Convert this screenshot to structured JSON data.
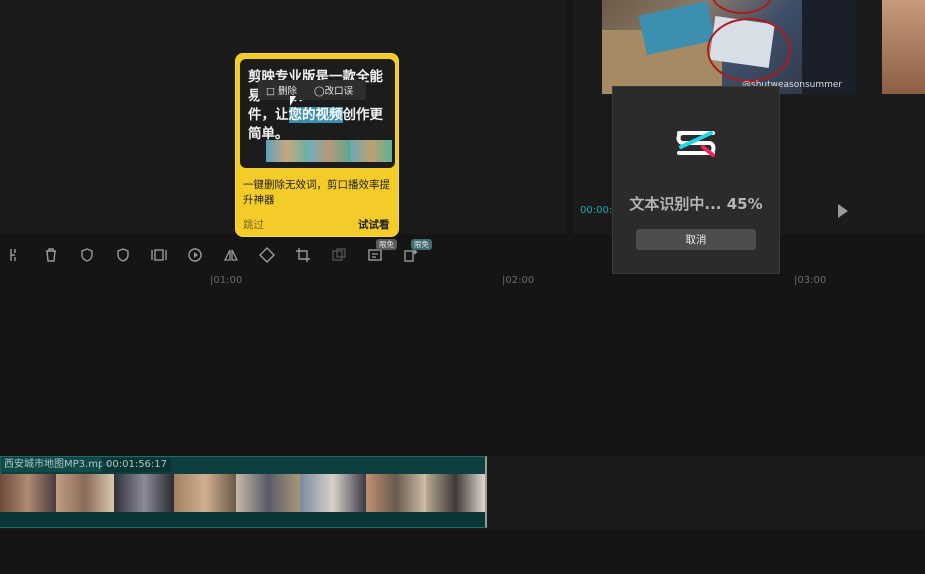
{
  "player": {
    "watermark": "@shutweasonsummer",
    "time_current": "00:00:"
  },
  "toolbar": {
    "badge_limited_1": "限免",
    "badge_limited_2": "限免"
  },
  "ruler": {
    "ticks": [
      "|01:00",
      "|02:00",
      "|03:00"
    ]
  },
  "track": {
    "clip_name": "西安城市地图MP3.mp4",
    "clip_duration": "00:01:56:17"
  },
  "feature_popup": {
    "preview_text_1": "剪映专业版是一款全能易",
    "preview_text_2": "用的",
    "preview_text_3": "软",
    "preview_text_4": "件，让",
    "preview_highlight": "您的视频",
    "preview_text_5": "创作更简单。",
    "menu_delete": "删除",
    "menu_fix": "改口误",
    "description": "一键删除无效词，剪口播效率提升神器",
    "skip_label": "跳过",
    "try_label": "试试看",
    "colors": {
      "background": "#f4cc2a"
    }
  },
  "progress_dialog": {
    "status_label": "文本识别中... 45%",
    "progress_percent": 45,
    "cancel_label": "取消"
  }
}
